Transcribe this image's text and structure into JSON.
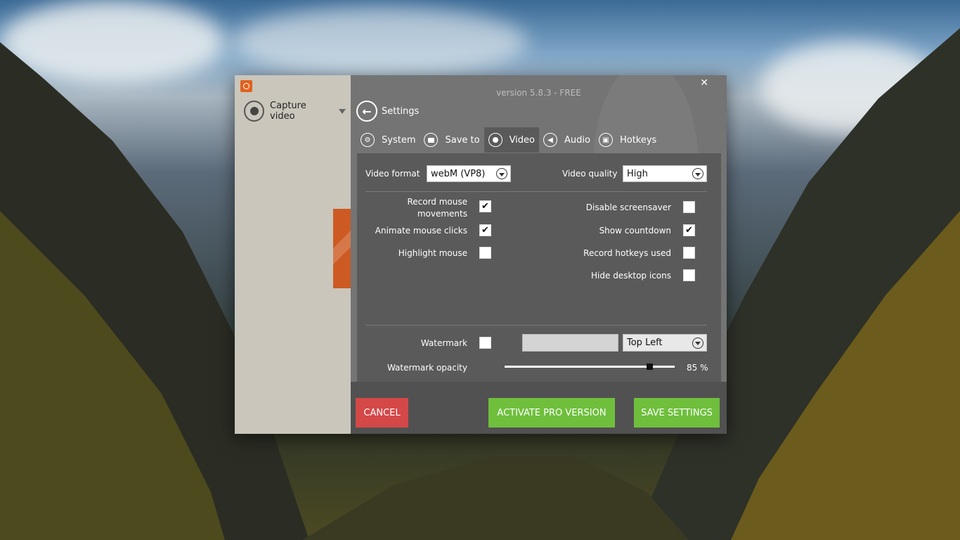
{
  "colors": {
    "cancel": "#d44848",
    "pro": "#6fbf3d",
    "save": "#6fbf3d",
    "accent": "#e0621e"
  },
  "sidebar": {
    "capture_label": "Capture video"
  },
  "header": {
    "version": "version 5.8.3 - FREE",
    "close_label": "✕",
    "back_icon": "←",
    "title": "Settings"
  },
  "tabs": [
    {
      "label": "System",
      "icon": "gear-icon"
    },
    {
      "label": "Save to",
      "icon": "folder-icon"
    },
    {
      "label": "Video",
      "icon": "record-icon",
      "active": true
    },
    {
      "label": "Audio",
      "icon": "speaker-icon"
    },
    {
      "label": "Hotkeys",
      "icon": "keyboard-icon"
    }
  ],
  "video": {
    "format_label": "Video format",
    "format_value": "webM (VP8)",
    "quality_label": "Video quality",
    "quality_value": "High",
    "options_left": [
      {
        "label_line1": "Record mouse",
        "label_line2": "movements",
        "checked": true
      },
      {
        "label": "Animate mouse clicks",
        "checked": true
      },
      {
        "label": "Highlight mouse",
        "checked": false
      }
    ],
    "options_right": [
      {
        "label": "Disable screensaver",
        "checked": false
      },
      {
        "label": "Show countdown",
        "checked": true
      },
      {
        "label": "Record hotkeys used",
        "checked": false
      },
      {
        "label": "Hide desktop icons",
        "checked": false
      }
    ],
    "watermark_label": "Watermark",
    "watermark_checked": false,
    "watermark_text": "",
    "watermark_position": "Top Left",
    "opacity_label": "Watermark opacity",
    "opacity_value": 85,
    "opacity_text": "85 %"
  },
  "footer": {
    "cancel": "CANCEL",
    "pro": "ACTIVATE PRO VERSION",
    "save": "SAVE SETTINGS"
  }
}
